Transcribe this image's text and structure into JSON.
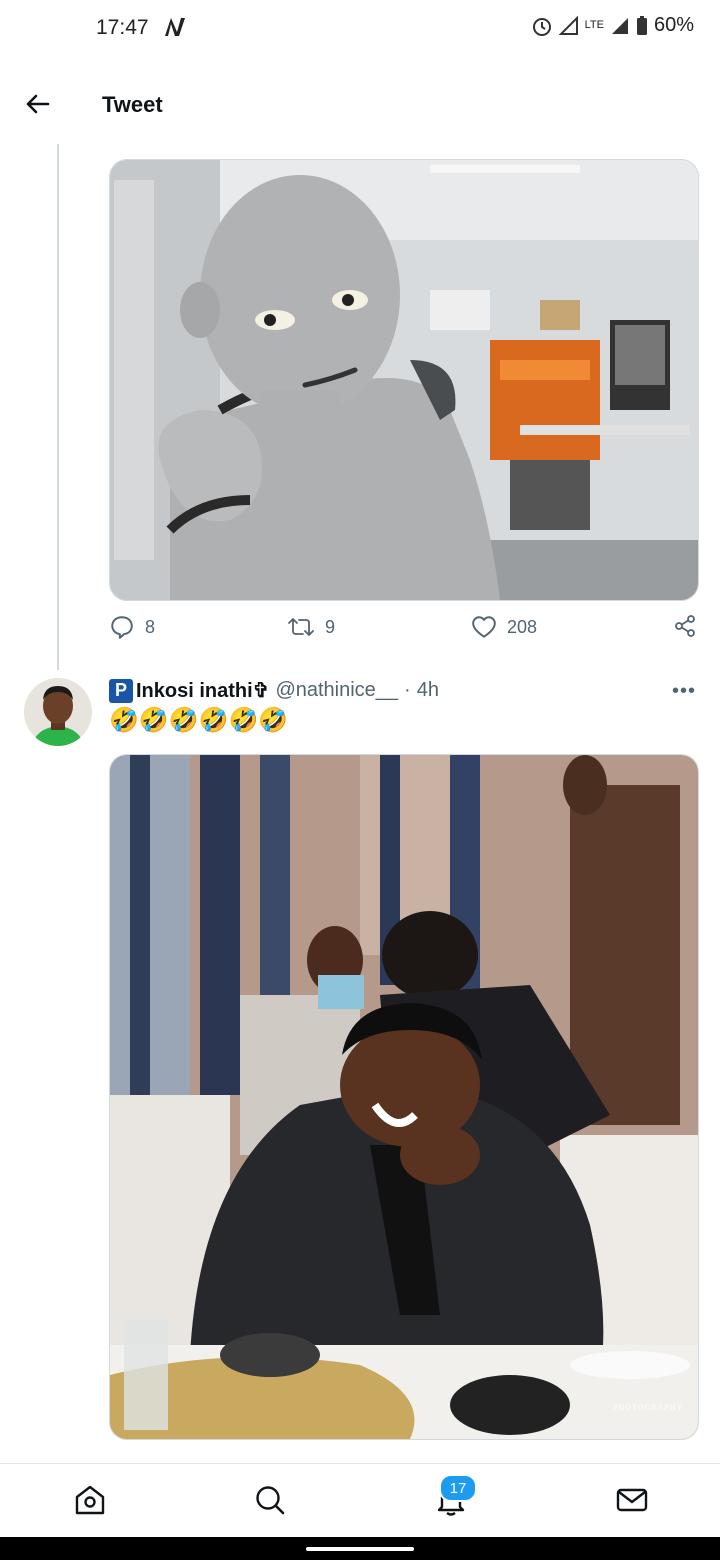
{
  "status_bar": {
    "time": "17:47",
    "network": "LTE",
    "battery": "60%"
  },
  "header": {
    "title": "Tweet"
  },
  "tweet1": {
    "image": "robot-child-photo",
    "replies": "8",
    "retweets": "9",
    "likes": "208"
  },
  "tweet2": {
    "badge": "P",
    "name": "Inkosi inathi✞",
    "handle": "@nathinice__",
    "separator": "·",
    "time": "4h",
    "text": "🤣🤣🤣🤣🤣🤣",
    "image": "laughing-man-photo",
    "watermark": "PHOTOGRAPHY"
  },
  "bottom_nav": {
    "notifications_badge": "17",
    "items": [
      "home-icon",
      "search-icon",
      "notifications-icon",
      "messages-icon"
    ]
  },
  "colors": {
    "accent": "#1d9bf0",
    "secondary_text": "#536471",
    "border": "#cfd9de"
  }
}
